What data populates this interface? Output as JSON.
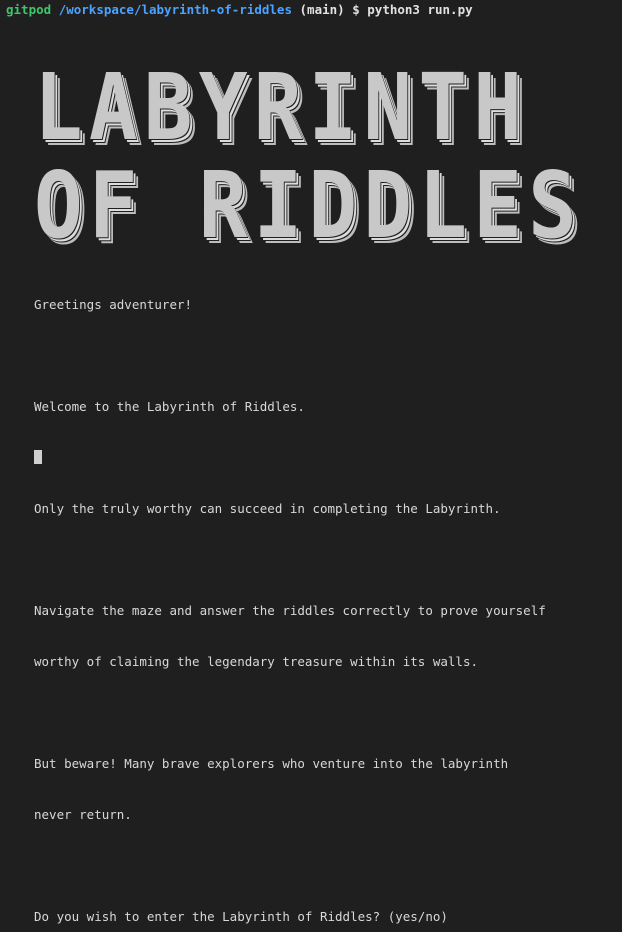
{
  "prompt": {
    "user": "gitpod",
    "path": "/workspace/labyrinth-of-riddles",
    "branch": "(main)",
    "symbol": "$",
    "command": "python3 run.py"
  },
  "banner": {
    "line1": "LABYRINTH",
    "line2": "OF RIDDLES"
  },
  "intro": {
    "greeting": "Greetings adventurer!",
    "welcome": "Welcome to the Labyrinth of Riddles.",
    "worthy": "Only the truly worthy can succeed in completing the Labyrinth.",
    "navigate_1": "Navigate the maze and answer the riddles correctly to prove yourself",
    "navigate_2": "worthy of claiming the legendary treasure within its walls.",
    "beware_1": "But beware! Many brave explorers who venture into the labyrinth",
    "beware_2": "never return.",
    "question": "Do you wish to enter the Labyrinth of Riddles? (yes/no)"
  },
  "colors": {
    "background": "#1f1f1f",
    "user": "#3fc56b",
    "path": "#4aa3ff",
    "text": "#d8d8d8"
  }
}
